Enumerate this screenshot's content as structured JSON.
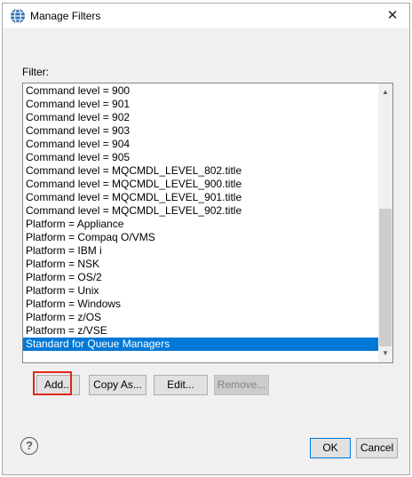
{
  "window": {
    "title": "Manage Filters"
  },
  "filter": {
    "label": "Filter:",
    "items": [
      "Command level = 900",
      "Command level = 901",
      "Command level = 902",
      "Command level = 903",
      "Command level = 904",
      "Command level = 905",
      "Command level = MQCMDL_LEVEL_802.title",
      "Command level = MQCMDL_LEVEL_900.title",
      "Command level = MQCMDL_LEVEL_901.title",
      "Command level = MQCMDL_LEVEL_902.title",
      "Platform = Appliance",
      "Platform = Compaq O/VMS",
      "Platform = IBM i",
      "Platform = NSK",
      "Platform = OS/2",
      "Platform = Unix",
      "Platform = Windows",
      "Platform = z/OS",
      "Platform = z/VSE",
      "Standard for Queue Managers"
    ],
    "selected_item": "Standard for Queue Managers"
  },
  "buttons": {
    "add": "Add...",
    "copy_as": "Copy As...",
    "edit": "Edit...",
    "remove": "Remove...",
    "ok": "OK",
    "cancel": "Cancel"
  },
  "icons": {
    "app": "globe-icon",
    "close": "close-icon",
    "help": "help-icon"
  },
  "colors": {
    "selection": "#0078d7",
    "highlight": "#e0271b"
  }
}
